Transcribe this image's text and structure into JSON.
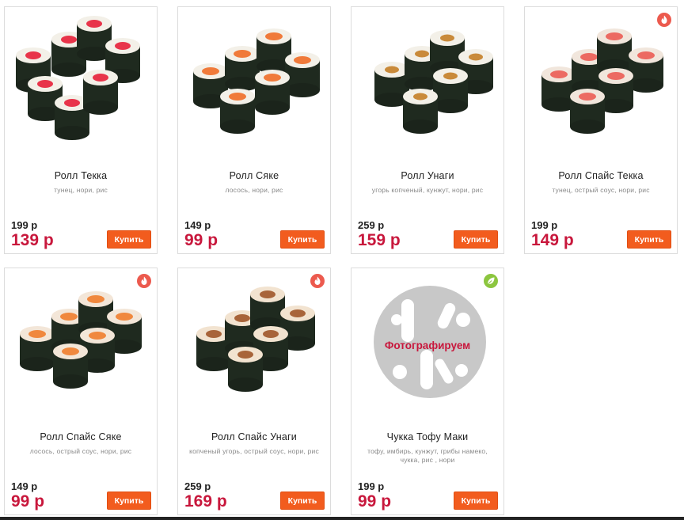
{
  "currency": "р",
  "products": [
    {
      "name": "Ролл Текка",
      "description": "тунец, нори, рис",
      "old_price": "199 р",
      "new_price": "139 р",
      "buy_label": "Купить",
      "badge": null,
      "image": "sushi-tuna-icon"
    },
    {
      "name": "Ролл Сяке",
      "description": "лосось, нори, рис",
      "old_price": "149 р",
      "new_price": "99 р",
      "buy_label": "Купить",
      "badge": null,
      "image": "sushi-salmon-icon"
    },
    {
      "name": "Ролл Унаги",
      "description": "угорь копченый, кунжут, нори, рис",
      "old_price": "259 р",
      "new_price": "159 р",
      "buy_label": "Купить",
      "badge": null,
      "image": "sushi-eel-icon"
    },
    {
      "name": "Ролл Спайс Текка",
      "description": "тунец, острый соус, нори, рис",
      "old_price": "199 р",
      "new_price": "149 р",
      "buy_label": "Купить",
      "badge": "spicy",
      "image": "sushi-spicy-tuna-icon"
    },
    {
      "name": "Ролл Спайс Сяке",
      "description": "лосось, острый соус, нори, рис",
      "old_price": "149 р",
      "new_price": "99 р",
      "buy_label": "Купить",
      "badge": "spicy",
      "image": "sushi-spicy-salmon-icon"
    },
    {
      "name": "Ролл Спайс Унаги",
      "description": "копченый угорь, острый соус, нори, рис",
      "old_price": "259 р",
      "new_price": "169 р",
      "buy_label": "Купить",
      "badge": "spicy",
      "image": "sushi-spicy-eel-icon"
    },
    {
      "name": "Чукка Тофу Маки",
      "description": "тофу, имбирь, кунжут, грибы намеко, чукка, рис , нори",
      "old_price": "199 р",
      "new_price": "99 р",
      "buy_label": "Купить",
      "badge": "vegetarian",
      "image": "photo-placeholder-icon",
      "placeholder_text": "Фотографируем"
    }
  ],
  "colors": {
    "price_accent": "#c8173c",
    "buy_button": "#f25c1e",
    "spicy_badge": "#ec5a4e",
    "veg_badge": "#8cc63f"
  }
}
